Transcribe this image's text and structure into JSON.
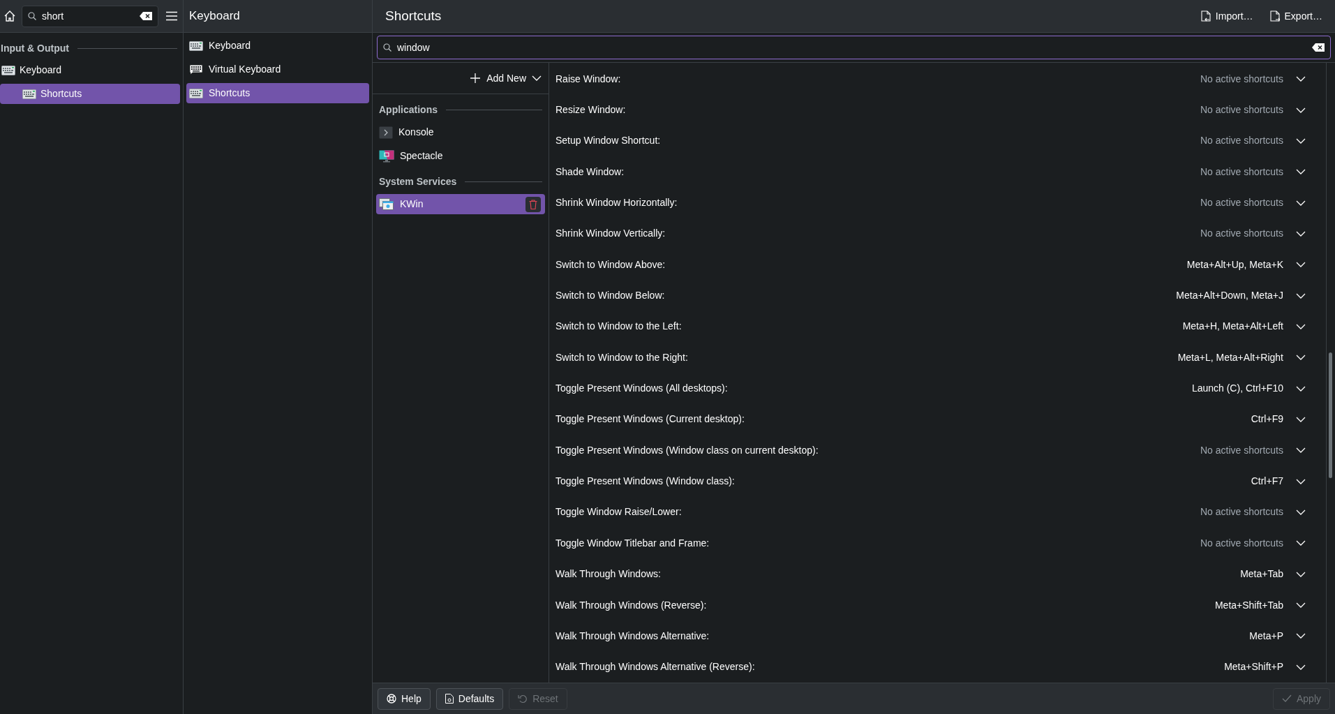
{
  "sidebar": {
    "search": {
      "value": "short"
    },
    "section": "Input & Output",
    "items": [
      {
        "label": "Keyboard",
        "selected": false,
        "children": [
          {
            "label": "Shortcuts",
            "selected": true
          }
        ]
      }
    ]
  },
  "module_list": {
    "title": "Keyboard",
    "items": [
      {
        "label": "Keyboard",
        "kind": "keyboard",
        "selected": false
      },
      {
        "label": "Virtual Keyboard",
        "kind": "virtual",
        "selected": false
      },
      {
        "label": "Shortcuts",
        "kind": "keyboard",
        "selected": true
      }
    ]
  },
  "page": {
    "title": "Shortcuts",
    "actions": [
      {
        "label": "Import…",
        "kind": "import"
      },
      {
        "label": "Export…",
        "kind": "export"
      }
    ],
    "search": {
      "value": "window"
    }
  },
  "components": {
    "add_new": "Add New",
    "groups": [
      {
        "title": "Applications",
        "items": [
          {
            "label": "Konsole",
            "kind": "terminal",
            "selected": false
          },
          {
            "label": "Spectacle",
            "kind": "screenshot",
            "selected": false
          }
        ]
      },
      {
        "title": "System Services",
        "items": [
          {
            "label": "KWin",
            "kind": "windows",
            "selected": true
          }
        ]
      }
    ]
  },
  "shortcuts": [
    {
      "action": "Raise Window:",
      "keys": "No active shortcuts",
      "active": false
    },
    {
      "action": "Resize Window:",
      "keys": "No active shortcuts",
      "active": false
    },
    {
      "action": "Setup Window Shortcut:",
      "keys": "No active shortcuts",
      "active": false
    },
    {
      "action": "Shade Window:",
      "keys": "No active shortcuts",
      "active": false
    },
    {
      "action": "Shrink Window Horizontally:",
      "keys": "No active shortcuts",
      "active": false
    },
    {
      "action": "Shrink Window Vertically:",
      "keys": "No active shortcuts",
      "active": false
    },
    {
      "action": "Switch to Window Above:",
      "keys": "Meta+Alt+Up, Meta+K",
      "active": true
    },
    {
      "action": "Switch to Window Below:",
      "keys": "Meta+Alt+Down, Meta+J",
      "active": true
    },
    {
      "action": "Switch to Window to the Left:",
      "keys": "Meta+H, Meta+Alt+Left",
      "active": true
    },
    {
      "action": "Switch to Window to the Right:",
      "keys": "Meta+L, Meta+Alt+Right",
      "active": true
    },
    {
      "action": "Toggle Present Windows (All desktops):",
      "keys": "Launch (C), Ctrl+F10",
      "active": true
    },
    {
      "action": "Toggle Present Windows (Current desktop):",
      "keys": "Ctrl+F9",
      "active": true
    },
    {
      "action": "Toggle Present Windows (Window class on current desktop):",
      "keys": "No active shortcuts",
      "active": false
    },
    {
      "action": "Toggle Present Windows (Window class):",
      "keys": "Ctrl+F7",
      "active": true
    },
    {
      "action": "Toggle Window Raise/Lower:",
      "keys": "No active shortcuts",
      "active": false
    },
    {
      "action": "Toggle Window Titlebar and Frame:",
      "keys": "No active shortcuts",
      "active": false
    },
    {
      "action": "Walk Through Windows:",
      "keys": "Meta+Tab",
      "active": true
    },
    {
      "action": "Walk Through Windows (Reverse):",
      "keys": "Meta+Shift+Tab",
      "active": true
    },
    {
      "action": "Walk Through Windows Alternative:",
      "keys": "Meta+P",
      "active": true
    },
    {
      "action": "Walk Through Windows Alternative (Reverse):",
      "keys": "Meta+Shift+P",
      "active": true
    }
  ],
  "footer": {
    "buttons": [
      {
        "label": "Help",
        "kind": "help",
        "disabled": false
      },
      {
        "label": "Defaults",
        "kind": "defaults",
        "disabled": false
      },
      {
        "label": "Reset",
        "kind": "reset",
        "disabled": true
      }
    ],
    "apply": {
      "label": "Apply",
      "disabled": true
    }
  }
}
